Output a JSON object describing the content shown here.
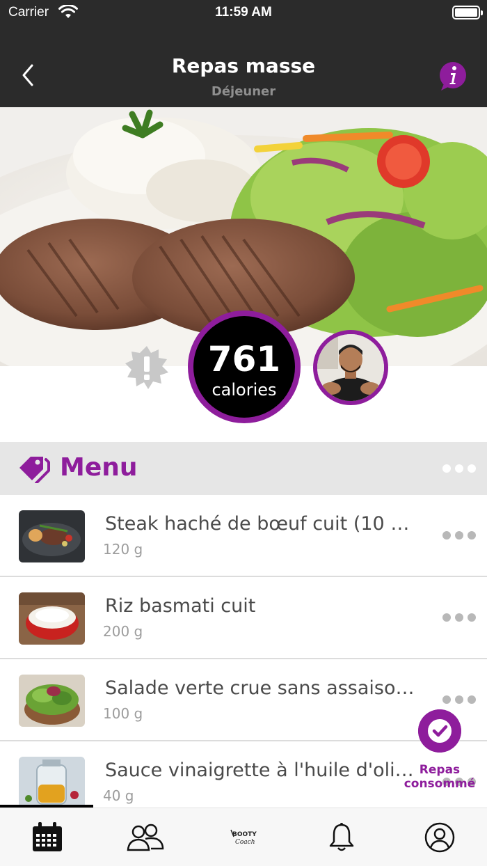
{
  "status_bar": {
    "carrier": "Carrier",
    "time": "11:59 AM"
  },
  "nav": {
    "title": "Repas masse",
    "subtitle": "Déjeuner",
    "back_icon": "chevron-left-icon",
    "info_icon": "info-bubble-icon"
  },
  "hero": {
    "calories_value": "761",
    "calories_label": "calories",
    "warning_icon": "exclamation-badge-icon"
  },
  "menu": {
    "title": "Menu",
    "icon": "tag-icon"
  },
  "foods": [
    {
      "name": "Steak haché de bœuf cuit (10 %…",
      "qty": "120 g"
    },
    {
      "name": "Riz basmati cuit",
      "qty": "200 g"
    },
    {
      "name": "Salade verte crue sans assaiso…",
      "qty": "100 g"
    },
    {
      "name": "Sauce vinaigrette à l'huile d'oli…",
      "qty": "40 g"
    }
  ],
  "consumed": {
    "label_line1": "Repas",
    "label_line2": "consommé"
  },
  "tabs": [
    {
      "icon": "calendar-icon"
    },
    {
      "icon": "community-icon"
    },
    {
      "icon": "booty-coach-logo",
      "logo_text": "BOOTY Coach"
    },
    {
      "icon": "bell-icon"
    },
    {
      "icon": "profile-icon"
    }
  ],
  "colors": {
    "accent": "#8e1d9c",
    "nav_background": "#2b2b2b",
    "section_background": "#e6e6e6"
  }
}
